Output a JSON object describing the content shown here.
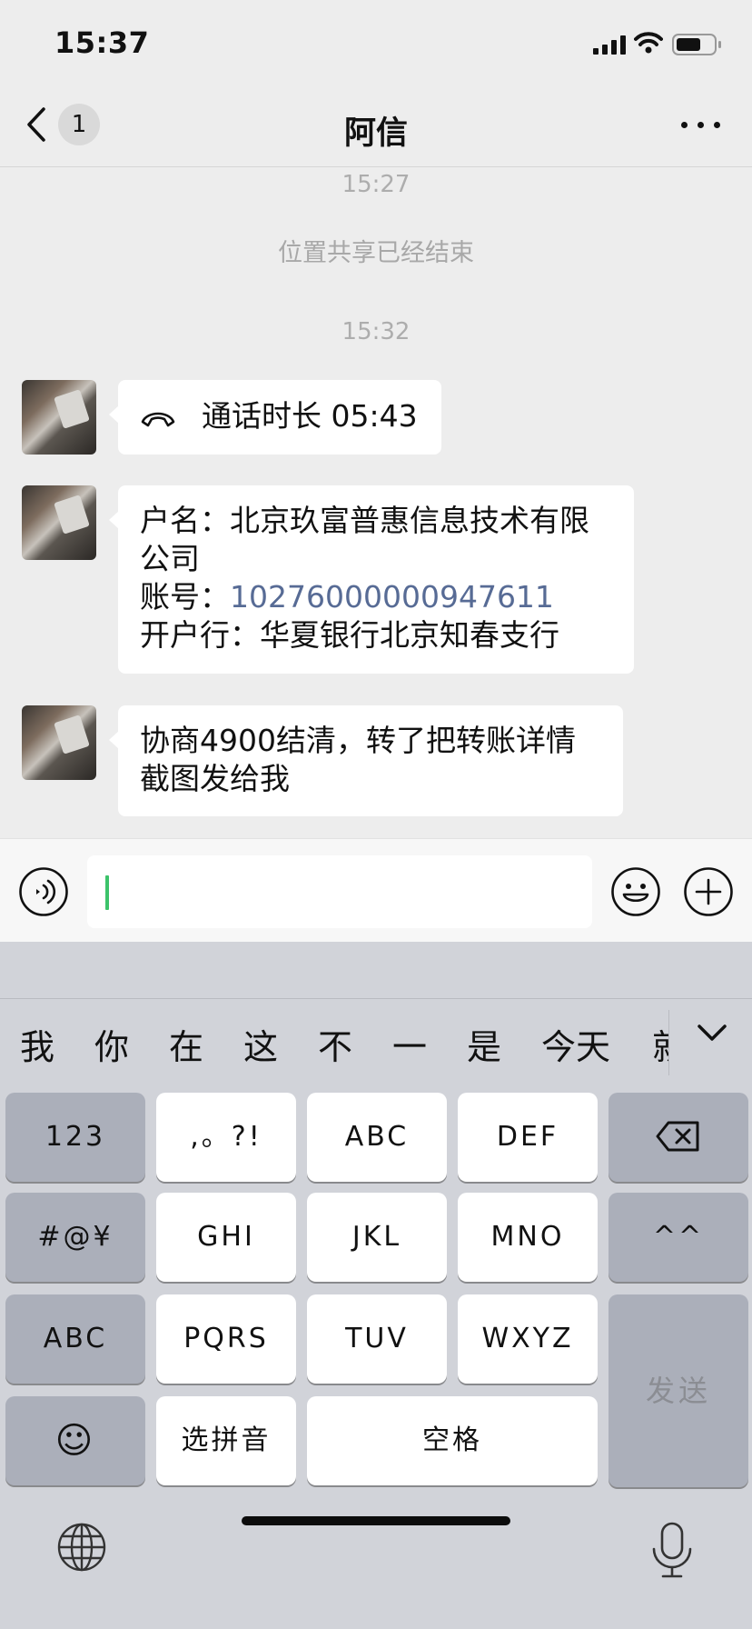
{
  "status_bar": {
    "time": "15:37",
    "icons": [
      "signal-icon",
      "wifi-icon",
      "battery-icon"
    ]
  },
  "nav": {
    "back_icon": "chevron-left-icon",
    "unread_count": "1",
    "title": "阿信",
    "more_icon": "more-icon"
  },
  "chat": {
    "time_1": "15:27",
    "system_note": "位置共享已经结束",
    "time_2": "15:32",
    "messages": [
      {
        "type": "call",
        "icon": "phone-hangup-icon",
        "text": "通话时长 05:43"
      },
      {
        "type": "text",
        "lines": [
          "户名：北京玖富普惠信息技术有限",
          "公司"
        ],
        "account_prefix": "账号：",
        "account_number": "10276000000947611",
        "bank_line": "开户行：华夏银行北京知春支行"
      },
      {
        "type": "text",
        "lines": [
          "协商4900结清，转了把转账详情",
          "截图发给我"
        ]
      }
    ]
  },
  "input_bar": {
    "voice_icon": "voice-icon",
    "emoji_icon": "emoji-icon",
    "add_icon": "plus-circle-icon",
    "value": ""
  },
  "keyboard": {
    "candidates": [
      "我",
      "你",
      "在",
      "这",
      "不",
      "一",
      "是",
      "今天",
      "就"
    ],
    "collapse_icon": "chevron-down-icon",
    "rows": [
      [
        "123",
        ",。?!",
        "ABC",
        "DEF",
        "⌫"
      ],
      [
        "#@¥",
        "GHI",
        "JKL",
        "MNO",
        "^^"
      ],
      [
        "ABC",
        "PQRS",
        "TUV",
        "WXYZ"
      ],
      [
        "☺",
        "选拼音",
        "空格"
      ]
    ],
    "send_label": "发送",
    "globe_icon": "globe-icon",
    "mic_icon": "microphone-icon"
  },
  "colors": {
    "accent_green": "#3cc36a",
    "link": "#576b95",
    "chat_bg": "#ededed",
    "keyboard_bg": "#d1d3d9"
  }
}
